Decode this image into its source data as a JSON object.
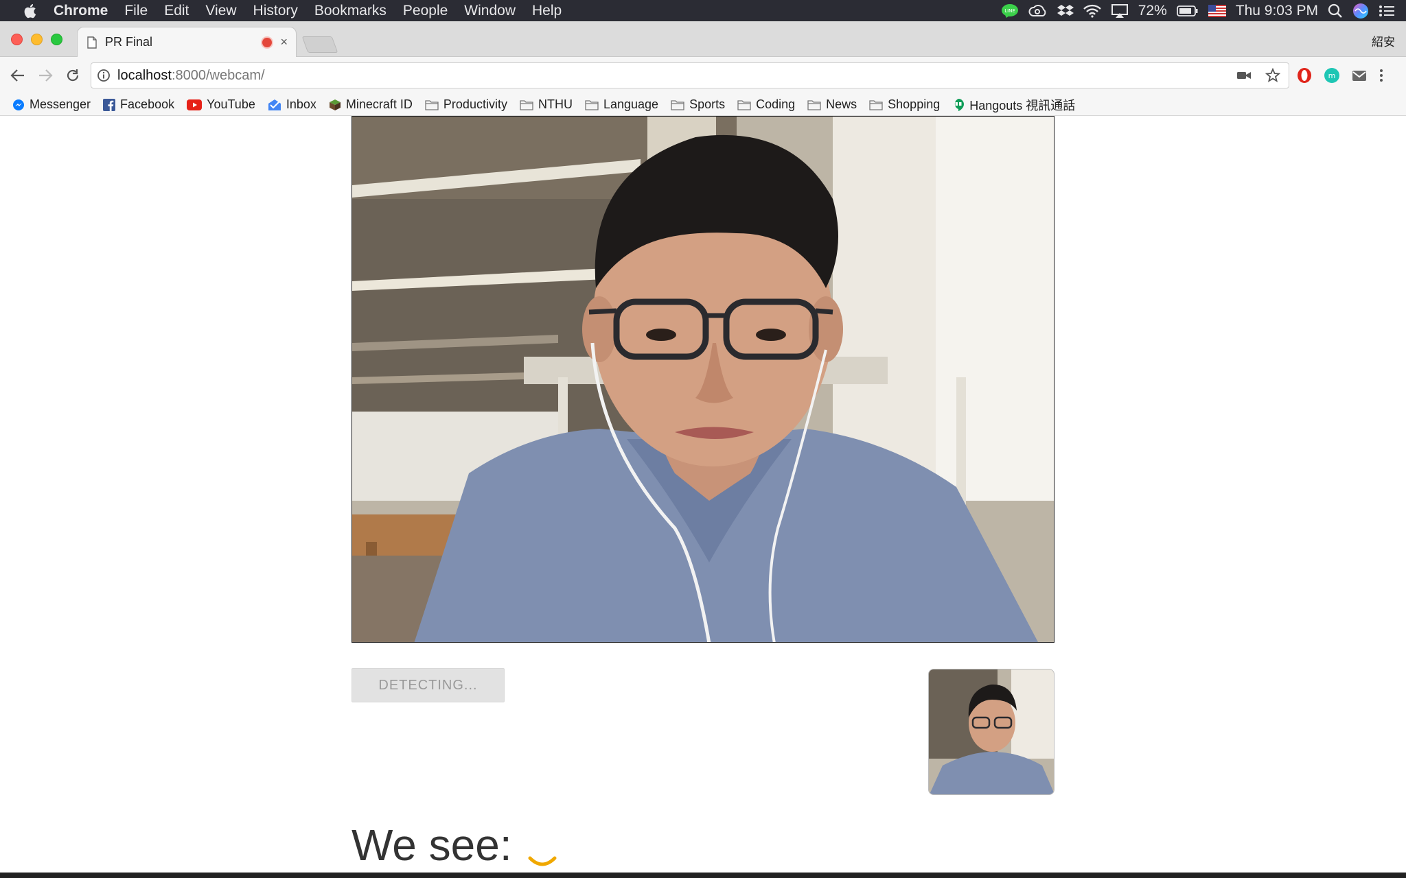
{
  "menubar": {
    "items": [
      "Chrome",
      "File",
      "Edit",
      "View",
      "History",
      "Bookmarks",
      "People",
      "Window",
      "Help"
    ],
    "battery": "72%",
    "clock": "Thu 9:03 PM"
  },
  "tab": {
    "title": "PR Final",
    "close": "×"
  },
  "profile": {
    "name": "紹安"
  },
  "omnibox": {
    "host": "localhost",
    "path": ":8000/webcam/"
  },
  "bookmarks": [
    {
      "label": "Messenger",
      "icon": "messenger-icon"
    },
    {
      "label": "Facebook",
      "icon": "facebook-icon"
    },
    {
      "label": "YouTube",
      "icon": "youtube-icon"
    },
    {
      "label": "Inbox",
      "icon": "inbox-icon"
    },
    {
      "label": "Minecraft ID",
      "icon": "minecraft-icon"
    },
    {
      "label": "Productivity",
      "icon": "folder-icon"
    },
    {
      "label": "NTHU",
      "icon": "folder-icon"
    },
    {
      "label": "Language",
      "icon": "folder-icon"
    },
    {
      "label": "Sports",
      "icon": "folder-icon"
    },
    {
      "label": "Coding",
      "icon": "folder-icon"
    },
    {
      "label": "News",
      "icon": "folder-icon"
    },
    {
      "label": "Shopping",
      "icon": "folder-icon"
    },
    {
      "label": "Hangouts 視訊通話",
      "icon": "hangouts-icon"
    }
  ],
  "page": {
    "detect_button": "DETECTING...",
    "result_label": "We see:"
  },
  "colors": {
    "menubar_bg": "#2b2c34",
    "spinner": "#f0a800",
    "button_disabled_bg": "#e2e2e2",
    "button_disabled_text": "#999999"
  }
}
